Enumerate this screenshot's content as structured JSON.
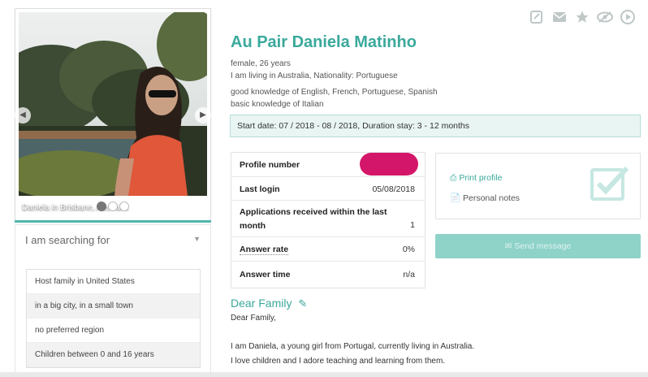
{
  "profile": {
    "name": "Au Pair Daniela Matinho",
    "gender_age": "female, 26 years",
    "location": "I am living in Australia, Nationality: Portuguese",
    "languages_good": "good knowledge of English, French, Portuguese, Spanish",
    "languages_basic": "basic knowledge of Italian",
    "start_date": "Start date: 07 / 2018 - 08 / 2018, Duration stay: 3 - 12 months"
  },
  "photo": {
    "caption": "Daniela in Brisbane, Australia",
    "prev_icon": "chevron-left-icon",
    "next_icon": "chevron-right-icon",
    "dots_total": 3,
    "active_dot": 1
  },
  "search": {
    "header": "I am searching for",
    "items": [
      "Host family in United States",
      "in a big city, in a small town",
      "no preferred region",
      "Children between 0 and 16 years"
    ]
  },
  "top_icons": [
    "edit-note-icon",
    "envelope-icon",
    "star-icon",
    "hide-eye-icon",
    "play-icon"
  ],
  "stats": {
    "profile_number_label": "Profile number",
    "profile_number_value": "",
    "last_login_label": "Last login",
    "last_login_value": "05/08/2018",
    "applications_label": "Applications received within the last month",
    "applications_value": "1",
    "answer_rate_label": "Answer rate",
    "answer_rate_value": "0%",
    "answer_time_label": "Answer time",
    "answer_time_value": "n/a"
  },
  "actions": {
    "print": "Print profile",
    "notes": "Personal notes",
    "send": "Send message"
  },
  "letter": {
    "title": "Dear Family",
    "greeting": "Dear Family,",
    "line1": "I am Daniela, a young girl from Portugal, currently living in Australia.",
    "line2": "I love children and I adore teaching and learning from them."
  },
  "colors": {
    "accent": "#3aa99c",
    "send_button": "#8ed2c8",
    "redaction": "#d4166a"
  }
}
